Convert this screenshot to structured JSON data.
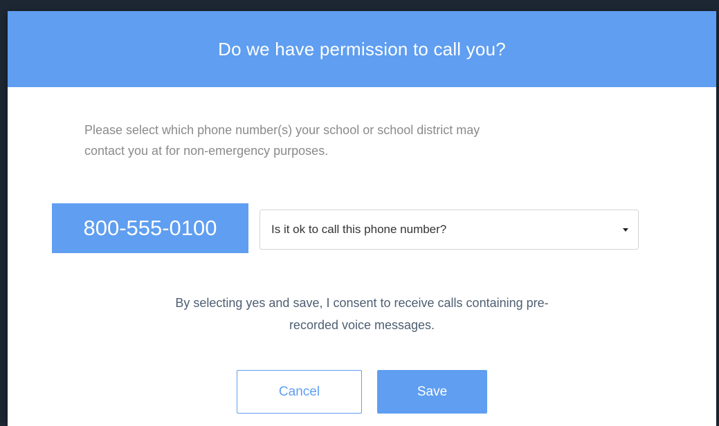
{
  "dialog": {
    "title": "Do we have permission to call you?",
    "intro_line1": "Please select which phone number(s) your school or school district may",
    "intro_line2": "contact you at for non-emergency purposes.",
    "phone_number": "800-555-0100",
    "call_permission_select": {
      "selected": "Is it ok to call this phone number?",
      "icon": "caret-down-icon"
    },
    "consent_line1": "By selecting yes and save, I consent to receive calls containing pre-",
    "consent_line2": "recorded voice messages.",
    "buttons": {
      "cancel_label": "Cancel",
      "save_label": "Save"
    }
  },
  "colors": {
    "accent": "#5f9ef0",
    "intro_text": "#8a8a8a",
    "consent_text": "#4d5e72",
    "backdrop": "#1c2733"
  }
}
